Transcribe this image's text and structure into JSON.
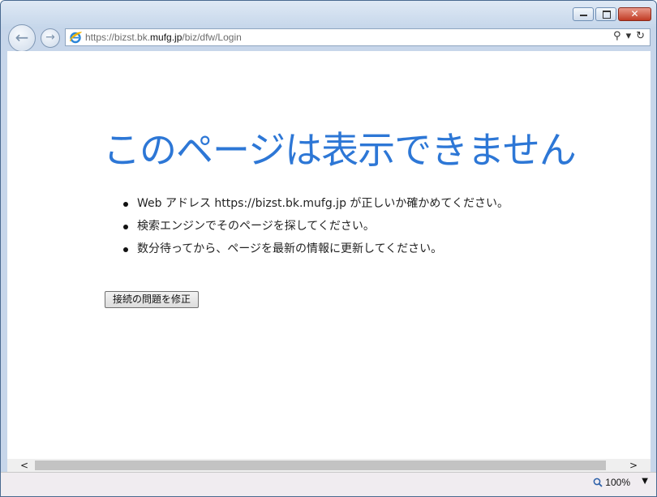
{
  "browser": {
    "address": {
      "url_prefix": "https://bizst.bk.",
      "url_host": "mufg.jp",
      "url_suffix": "/biz/dfw/Login"
    },
    "window_controls": {
      "close_glyph": "✕"
    },
    "nav": {
      "back_glyph": "←",
      "forward_glyph": "→"
    },
    "address_tools": {
      "search_glyph": "⚲",
      "dropdown_glyph": "▾",
      "refresh_glyph": "↻"
    },
    "zoom": {
      "level": "100%",
      "dropdown_glyph": "▼"
    },
    "scrollbar": {
      "left_glyph": "<",
      "right_glyph": ">"
    }
  },
  "page": {
    "heading": "このページは表示できません",
    "suggestions": [
      "Web アドレス https://bizst.bk.mufg.jp が正しいか確かめてください。",
      "検索エンジンでそのページを探してください。",
      "数分待ってから、ページを最新の情報に更新してください。"
    ],
    "fix_button": "接続の問題を修正"
  },
  "colors": {
    "heading": "#2d77d6",
    "close_button": "#c13b24"
  }
}
